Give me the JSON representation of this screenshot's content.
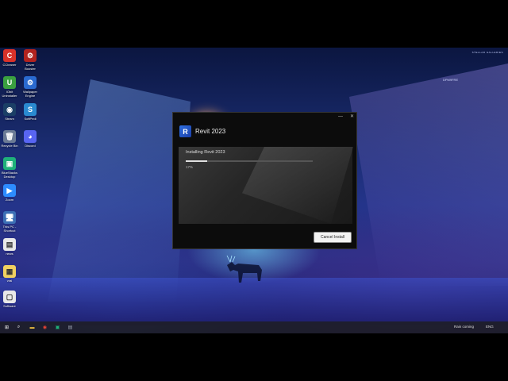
{
  "desktop": {
    "brand_text": "STELLAR GALLERIES",
    "watermark_text": "DPM9FRE",
    "icons": [
      {
        "label": "CCleaner",
        "glyph": "C",
        "color": "#d9322a"
      },
      {
        "label": "Driver\nBooster",
        "glyph": "⚙",
        "color": "#b2231f"
      },
      {
        "label": "IObit\nUninstaller",
        "glyph": "U",
        "color": "#3aa040"
      },
      {
        "label": "Wallpaper\nEngine",
        "glyph": "⚙",
        "color": "#2a6ad0"
      },
      {
        "label": "Steam",
        "glyph": "◉",
        "color": "#1b3f66"
      },
      {
        "label": "SoftPedi",
        "glyph": "S",
        "color": "#2a8ad0"
      },
      {
        "label": "Recycle Bin",
        "glyph": "🗑",
        "color": "#6b7b95"
      },
      {
        "label": "Discord",
        "glyph": "◕",
        "color": "#5865f2"
      },
      {
        "label": "BlueStacks\nDesktop",
        "glyph": "▣",
        "color": "#1fb17a"
      },
      {
        "label": "Zoom",
        "glyph": "▶",
        "color": "#2d8cff"
      },
      {
        "label": "This PC -\nShortcut",
        "glyph": "🖥",
        "color": "#3c6fb5"
      },
      {
        "label": "news",
        "glyph": "▤",
        "color": "#e8e8e8"
      },
      {
        "label": "vrai",
        "glyph": "▦",
        "color": "#f0d060"
      },
      {
        "label": "Software",
        "glyph": "▢",
        "color": "#e8e8e8"
      }
    ]
  },
  "dialog": {
    "title": "Revit 2023",
    "logo_letter": "R",
    "installing_label": "Installing Revit 2023",
    "progress_text": "17%",
    "progress": 0.17,
    "cancel_label": "Cancel Install",
    "minimize_glyph": "—",
    "close_glyph": "✕"
  },
  "taskbar": {
    "start_glyph": "⊞",
    "search_glyph": "⌕",
    "apps": [
      {
        "name": "file-explorer",
        "glyph": "▬",
        "color": "#f0c040"
      },
      {
        "name": "chrome",
        "glyph": "◉",
        "color": "#ea4335"
      },
      {
        "name": "bluestacks",
        "glyph": "▣",
        "color": "#1fb17a"
      },
      {
        "name": "installer",
        "glyph": "▤",
        "color": "#9aa0b0"
      }
    ],
    "weather_text": "Rain coming",
    "lang_text": "ENG"
  }
}
